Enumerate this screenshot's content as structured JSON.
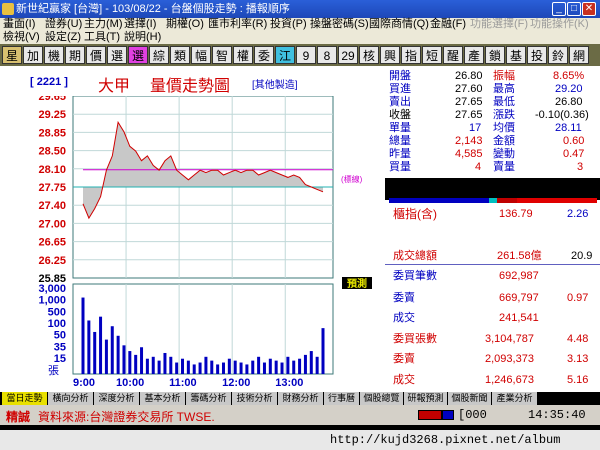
{
  "window": {
    "title": "新世紀贏家 [台灣] - 103/08/22 - 台盤個股走勢 : 播報順序",
    "min_icon": "_",
    "max_icon": "□",
    "close_icon": "✕"
  },
  "menu": {
    "row1": [
      "畫面(I)",
      "證券(U)",
      "主力(M)",
      "選擇(I)",
      "期權(O)",
      "匯市利率(R)",
      "投資(P)",
      "操盤密碼(S)",
      "國際商情(Q)",
      "金融(F)",
      "功能選擇(F)",
      "功能操作(K)"
    ],
    "row2": [
      "檢視(V)",
      "設定(Z)",
      "工具(T)",
      "說明(H)"
    ]
  },
  "toolbar": [
    "星",
    "加",
    "機",
    "期",
    "價",
    "選",
    "選",
    "綜",
    "類",
    "幅",
    "智",
    "權",
    "委",
    "江",
    "9",
    "8",
    "29",
    "核",
    "興",
    "指",
    "短",
    "醒",
    "產",
    "鎖",
    "基",
    "投",
    "鈴",
    "網"
  ],
  "header": {
    "code": "[ 2221 ]",
    "name": "大甲",
    "chart_title": "量價走勢圖",
    "tag": "[其他製造]"
  },
  "chart_data": {
    "type": "line",
    "price_ticks": [
      "29.65",
      "29.25",
      "28.85",
      "28.50",
      "28.10",
      "27.75",
      "27.40",
      "27.00",
      "26.65",
      "26.25",
      "25.85"
    ],
    "volume_ticks": [
      "3,000",
      "1,000",
      "500",
      "100",
      "50",
      "35",
      "15"
    ],
    "volume_unit": "張",
    "x_ticks": [
      "9:00",
      "10:00",
      "11:00",
      "12:00",
      "13:00"
    ],
    "price_range": [
      25.85,
      29.65
    ],
    "reference_price": 27.75,
    "avg_price": 28.11,
    "y_label_ref": "(標線)",
    "predict_label": "預測",
    "price_series": [
      27.4,
      27.1,
      27.3,
      27.55,
      28.1,
      28.4,
      29.1,
      28.9,
      28.6,
      28.5,
      28.3,
      28.4,
      28.2,
      28.1,
      28.3,
      28.4,
      28.1,
      28.0,
      27.9,
      28.0,
      28.1,
      28.05,
      28.1,
      28.1,
      28.0,
      28.05,
      28.1,
      28.05,
      28.1,
      28.1,
      28.0,
      28.05,
      28.1,
      28.05,
      28.0,
      27.95,
      28.0,
      27.95,
      27.8,
      27.75,
      27.7,
      27.65
    ],
    "volume_series": [
      40,
      28,
      22,
      30,
      18,
      25,
      20,
      15,
      12,
      10,
      14,
      8,
      9,
      7,
      11,
      9,
      6,
      8,
      7,
      5,
      6,
      9,
      7,
      5,
      6,
      8,
      7,
      6,
      5,
      7,
      9,
      6,
      8,
      7,
      6,
      9,
      7,
      8,
      10,
      12,
      9,
      24
    ]
  },
  "quote": {
    "open_label": "開盤",
    "open": "26.80",
    "amp_label": "振幅",
    "amp": "8.65%",
    "bid_label": "買進",
    "bid": "27.60",
    "high_label": "最高",
    "high": "29.20",
    "ask_label": "賣出",
    "ask": "27.65",
    "low_label": "最低",
    "low": "26.80",
    "close_label": "收盤",
    "close": "27.65",
    "chg_label": "漲跌",
    "chg": "-0.10(0.36)",
    "lot_label": "單量",
    "lot": "17",
    "avgp_label": "均價",
    "avgp": "28.11",
    "vol_label": "總量",
    "vol": "2,143",
    "amt_label": "金額",
    "amt": "0.60",
    "yvol_label": "昨量",
    "yvol": "4,585",
    "var_label": "變動",
    "var": "0.47",
    "buyq_label": "買量",
    "buyq": "4",
    "sellq_label": "賣量",
    "sellq": "3",
    "index_label": "櫃指(含)",
    "index_val": "136.79",
    "index_chg": "2.26",
    "turnover_label": "成交總額",
    "turnover": "261.58億",
    "turnover_pct": "20.9",
    "bidcnt_label": "委買筆數",
    "bidcnt": "692,987",
    "askcnt_label": "委賣",
    "askcnt": "669,797",
    "askcnt_r": "0.97",
    "dealcnt_label": "成交",
    "dealcnt": "241,541",
    "bidlot_label": "委買張數",
    "bidlot": "3,104,787",
    "bidlot_r": "4.48",
    "asklot_label": "委賣",
    "asklot": "2,093,373",
    "asklot_r": "3.13",
    "deallot_label": "成交",
    "deallot": "1,246,673",
    "deallot_r": "5.16"
  },
  "tabs": [
    "當日走勢",
    "橫向分析",
    "深度分析",
    "基本分析",
    "籌碼分析",
    "技術分析",
    "財務分析",
    "行事曆",
    "個股總覽",
    "研報預測",
    "個股新聞",
    "產業分析"
  ],
  "status": {
    "mode": "精誠",
    "source": "資料來源:台灣證券交易所 TWSE.",
    "box": "[000",
    "time": "14:35:40"
  },
  "url": "http://kujd3268.pixnet.net/album"
}
